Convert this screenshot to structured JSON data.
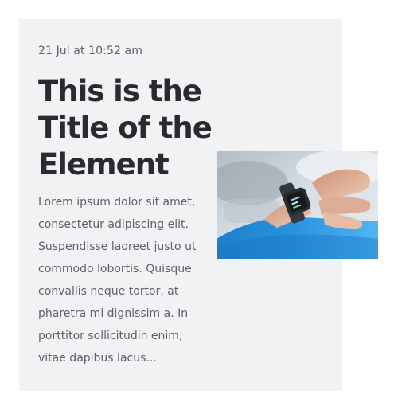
{
  "post": {
    "date": "21 Jul at 10:52 am",
    "title": "This is the\nTitle of the\nElement",
    "excerpt": "Lorem ipsum dolor sit amet,\nconsectetur adipiscing elit.\nSuspendisse laoreet justo ut\ncommodo lobortis. Quisque\nconvallis neque tortor, at\npharetra mi dignissim a. In\nporttitor sollicitudin enim,\nvitae dapibus lacus...",
    "image": {
      "subject": "smartwatch-on-wrist",
      "colors": {
        "sleeve": "#1e8fe0",
        "background": "#c9d3dc",
        "skin": "#e2b59c"
      }
    }
  },
  "colors": {
    "card_background": "#f1f2f4",
    "title": "#2a2b2f",
    "body_text": "#5e6168"
  }
}
